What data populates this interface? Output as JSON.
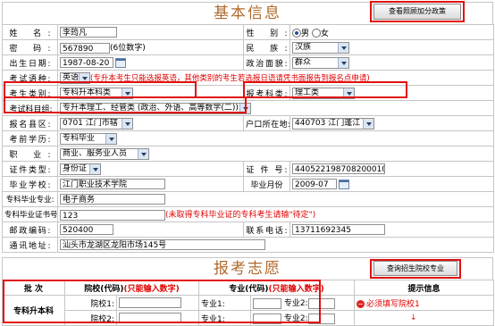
{
  "basic_info": {
    "title": "基本信息",
    "policy_button": "查看照顾加分政策",
    "rows": {
      "name": {
        "label": "姓  名:",
        "value": "李筠凡"
      },
      "gender": {
        "label": "性  别:",
        "options": [
          "男",
          "女"
        ],
        "selected": "男"
      },
      "password": {
        "label": "密  码:",
        "value": "567890",
        "hint": "(6位数字)"
      },
      "ethnicity": {
        "label": "民  族:",
        "value": "汉族"
      },
      "birthdate": {
        "label": "出生日期:",
        "value": "1987-08-20"
      },
      "political": {
        "label": "政治面貌:",
        "value": "群众"
      },
      "exam_language": {
        "label": "考试语种:",
        "value": "英语",
        "note": "(专升本考生只能选报英语，其他类别的考生若选报日语请凭书面报告到报名点申请)"
      },
      "candidate_type": {
        "label": "考生类别:",
        "value": "专科升本科类"
      },
      "exam_category": {
        "label": "报考科类:",
        "value": "理工类"
      },
      "exam_subjects": {
        "label": "考试科目组:",
        "value": "专升本理工、经管类  (政治、外语、高等数学(二))"
      },
      "exam_district": {
        "label": "报名县区:",
        "value": "0701  江门市辖"
      },
      "hukou": {
        "label": "户口所在地:",
        "value": "440703 江门蓬江"
      },
      "education": {
        "label": "考前学历:",
        "value": "专科毕业"
      },
      "occupation": {
        "label": "职  业:",
        "value": "商业、服务业人员"
      },
      "id_type": {
        "label": "证件类型:",
        "value": "身份证"
      },
      "id_number": {
        "label": "证 件 号:",
        "value": "440522198708200010"
      },
      "school": {
        "label": "毕业学校:",
        "value": "江门职业技术学院"
      },
      "grad_month": {
        "label": "毕业月份",
        "value": "2009-07"
      },
      "major": {
        "label": "专科毕业专业:",
        "value": "电子商务"
      },
      "cert_no": {
        "label": "专科毕业证书号",
        "value": "123",
        "note": "(未取得专科毕业证的专科考生请输\"待定\")"
      },
      "postcode": {
        "label": "邮政编码:",
        "value": "520400"
      },
      "phone": {
        "label": "联系电话:",
        "value": "13711692345"
      },
      "address": {
        "label": "通讯地址:",
        "value": "汕头市龙湖区龙阳市场145号"
      }
    }
  },
  "application": {
    "title": "报考志愿",
    "query_button": "查询招生院校专业",
    "headers": {
      "batch": "批  次",
      "school_code": "院校(代码)",
      "school_hint": "(只能输入数字)",
      "major_code": "专业(代码)",
      "major_hint": "(只能输入数字)",
      "tips": "提示信息"
    },
    "batch_name": "专科升本科",
    "school_1": "院校1:",
    "school_2": "院校2:",
    "major_1": "专业1:",
    "major_2": "专业2:",
    "major_1b": "专业1:",
    "major_2b": "专业2:",
    "warning": "必须填写院校1"
  },
  "colors": {
    "title": "#b06a2c",
    "highlight": "#e01010",
    "note": "#e00000"
  }
}
